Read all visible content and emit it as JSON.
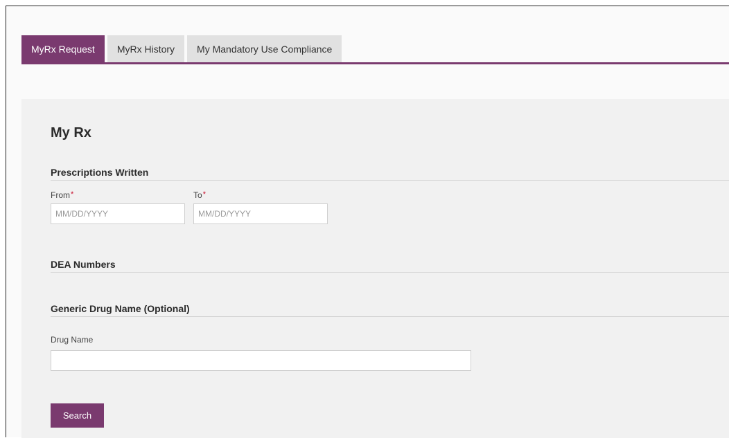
{
  "tabs": [
    {
      "label": "MyRx Request",
      "active": true
    },
    {
      "label": "MyRx History",
      "active": false
    },
    {
      "label": "My Mandatory Use Compliance",
      "active": false
    }
  ],
  "page": {
    "title": "My Rx"
  },
  "prescriptions": {
    "heading": "Prescriptions Written",
    "from_label": "From",
    "to_label": "To",
    "required_mark": "*",
    "from_placeholder": "MM/DD/YYYY",
    "to_placeholder": "MM/DD/YYYY",
    "from_value": "",
    "to_value": ""
  },
  "dea": {
    "heading": "DEA Numbers"
  },
  "generic": {
    "heading": "Generic Drug Name (Optional)",
    "drug_label": "Drug Name",
    "drug_value": ""
  },
  "actions": {
    "search_label": "Search"
  },
  "colors": {
    "accent": "#7a3a6f",
    "required": "#c8102e",
    "panel": "#f1f1f1"
  }
}
